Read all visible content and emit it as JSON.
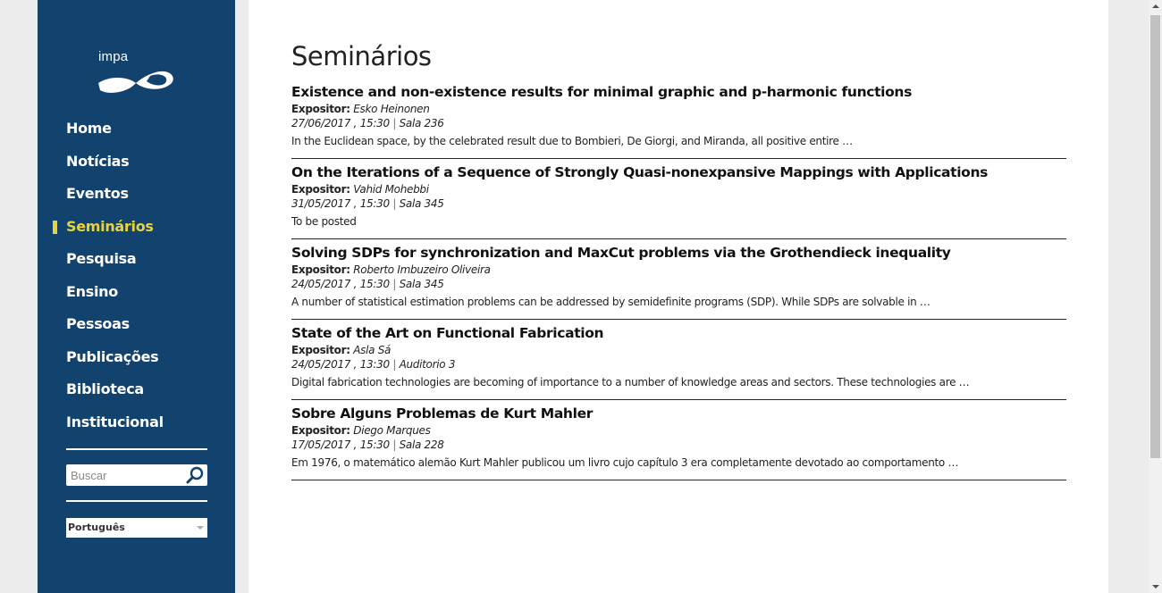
{
  "logo": {
    "text": "impa"
  },
  "nav": {
    "items": [
      {
        "label": "Home"
      },
      {
        "label": "Notícias"
      },
      {
        "label": "Eventos"
      },
      {
        "label": "Seminários",
        "active": true
      },
      {
        "label": "Pesquisa"
      },
      {
        "label": "Ensino"
      },
      {
        "label": "Pessoas"
      },
      {
        "label": "Publicações"
      },
      {
        "label": "Biblioteca"
      },
      {
        "label": "Institucional"
      }
    ]
  },
  "search": {
    "placeholder": "Buscar"
  },
  "language": {
    "selected": "Português"
  },
  "page": {
    "title": "Seminários"
  },
  "seminar_labels": {
    "speaker_label": "Expositor:",
    "separator": "|"
  },
  "seminars": [
    {
      "title": "Existence and non-existence results for minimal graphic and p-harmonic functions",
      "speaker": "Esko Heinonen",
      "datetime": "27/06/2017 , 15:30",
      "room": "Sala 236",
      "abstract": " In the Euclidean space, by the celebrated result due to Bombieri, De Giorgi, and Miranda, all positive entire …"
    },
    {
      "title": "On the Iterations of a Sequence of Strongly Quasi-nonexpansive Mappings with Applications",
      "speaker": "Vahid Mohebbi",
      "datetime": "31/05/2017 , 15:30",
      "room": "Sala 345",
      "abstract": "To be posted"
    },
    {
      "title": "Solving SDPs for synchronization and MaxCut problems via the Grothendieck inequality",
      "speaker": "Roberto Imbuzeiro Oliveira",
      "datetime": "24/05/2017 , 15:30",
      "room": "Sala 345",
      "abstract": " A number of statistical estimation problems can be addressed by semidefinite programs (SDP). While SDPs are solvable in …"
    },
    {
      "title": "State of the Art on Functional Fabrication",
      "speaker": "Asla Sá",
      "datetime": "24/05/2017 , 13:30",
      "room": "Auditorio 3",
      "abstract": "Digital fabrication technologies are becoming of importance to a number of knowledge areas and sectors. These technologies are …"
    },
    {
      "title": "Sobre Alguns Problemas de Kurt Mahler",
      "speaker": "Diego Marques",
      "datetime": "17/05/2017 , 15:30",
      "room": "Sala 228",
      "abstract": "Em 1976, o matemático alemão Kurt Mahler publicou um livro cujo capítulo 3 era completamente devotado ao comportamento …"
    }
  ],
  "colors": {
    "sidebar_bg": "#12426e",
    "active_accent": "#e8d33b",
    "text": "#111111"
  }
}
